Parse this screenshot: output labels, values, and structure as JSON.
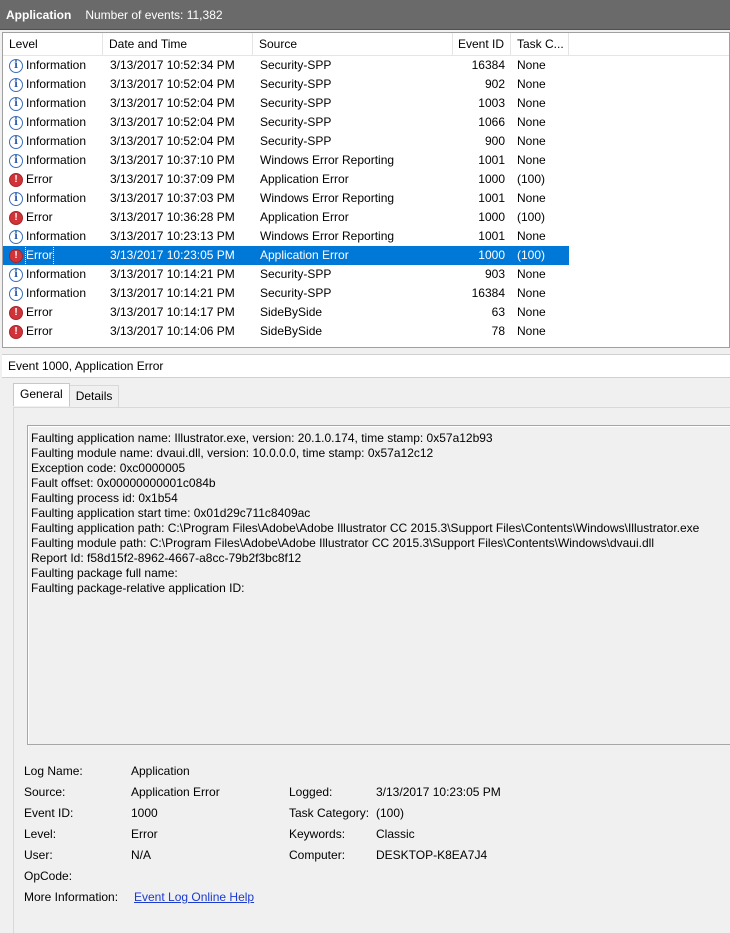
{
  "header": {
    "title": "Application",
    "count_text": "Number of events: 11,382"
  },
  "columns": {
    "level": "Level",
    "date": "Date and Time",
    "source": "Source",
    "event_id": "Event ID",
    "task": "Task C..."
  },
  "rows": [
    {
      "level": "Information",
      "date": "3/13/2017 10:52:34 PM",
      "source": "Security-SPP",
      "id": "16384",
      "task": "None",
      "icon": "info-icon"
    },
    {
      "level": "Information",
      "date": "3/13/2017 10:52:04 PM",
      "source": "Security-SPP",
      "id": "902",
      "task": "None",
      "icon": "info-icon"
    },
    {
      "level": "Information",
      "date": "3/13/2017 10:52:04 PM",
      "source": "Security-SPP",
      "id": "1003",
      "task": "None",
      "icon": "info-icon"
    },
    {
      "level": "Information",
      "date": "3/13/2017 10:52:04 PM",
      "source": "Security-SPP",
      "id": "1066",
      "task": "None",
      "icon": "info-icon"
    },
    {
      "level": "Information",
      "date": "3/13/2017 10:52:04 PM",
      "source": "Security-SPP",
      "id": "900",
      "task": "None",
      "icon": "info-icon"
    },
    {
      "level": "Information",
      "date": "3/13/2017 10:37:10 PM",
      "source": "Windows Error Reporting",
      "id": "1001",
      "task": "None",
      "icon": "info-icon"
    },
    {
      "level": "Error",
      "date": "3/13/2017 10:37:09 PM",
      "source": "Application Error",
      "id": "1000",
      "task": "(100)",
      "icon": "error-icon"
    },
    {
      "level": "Information",
      "date": "3/13/2017 10:37:03 PM",
      "source": "Windows Error Reporting",
      "id": "1001",
      "task": "None",
      "icon": "info-icon"
    },
    {
      "level": "Error",
      "date": "3/13/2017 10:36:28 PM",
      "source": "Application Error",
      "id": "1000",
      "task": "(100)",
      "icon": "error-icon"
    },
    {
      "level": "Information",
      "date": "3/13/2017 10:23:13 PM",
      "source": "Windows Error Reporting",
      "id": "1001",
      "task": "None",
      "icon": "info-icon"
    },
    {
      "level": "Error",
      "date": "3/13/2017 10:23:05 PM",
      "source": "Application Error",
      "id": "1000",
      "task": "(100)",
      "icon": "error-icon",
      "selected": true
    },
    {
      "level": "Information",
      "date": "3/13/2017 10:14:21 PM",
      "source": "Security-SPP",
      "id": "903",
      "task": "None",
      "icon": "info-icon"
    },
    {
      "level": "Information",
      "date": "3/13/2017 10:14:21 PM",
      "source": "Security-SPP",
      "id": "16384",
      "task": "None",
      "icon": "info-icon"
    },
    {
      "level": "Error",
      "date": "3/13/2017 10:14:17 PM",
      "source": "SideBySide",
      "id": "63",
      "task": "None",
      "icon": "error-icon"
    },
    {
      "level": "Error",
      "date": "3/13/2017 10:14:06 PM",
      "source": "SideBySide",
      "id": "78",
      "task": "None",
      "icon": "error-icon"
    }
  ],
  "detail": {
    "title": "Event 1000, Application Error",
    "tabs": [
      "General",
      "Details"
    ],
    "description": [
      "Faulting application name: Illustrator.exe, version: 20.1.0.174, time stamp: 0x57a12b93",
      "Faulting module name: dvaui.dll, version: 10.0.0.0, time stamp: 0x57a12c12",
      "Exception code: 0xc0000005",
      "Fault offset: 0x00000000001c084b",
      "Faulting process id: 0x1b54",
      "Faulting application start time: 0x01d29c711c8409ac",
      "Faulting application path: C:\\Program Files\\Adobe\\Adobe Illustrator CC 2015.3\\Support Files\\Contents\\Windows\\Illustrator.exe",
      "Faulting module path: C:\\Program Files\\Adobe\\Adobe Illustrator CC 2015.3\\Support Files\\Contents\\Windows\\dvaui.dll",
      "Report Id: f58d15f2-8962-4667-a8cc-79b2f3bc8f12",
      "Faulting package full name:",
      "Faulting package-relative application ID:"
    ],
    "props": {
      "log_name_label": "Log Name:",
      "log_name": "Application",
      "source_label": "Source:",
      "source": "Application Error",
      "logged_label": "Logged:",
      "logged": "3/13/2017 10:23:05 PM",
      "event_id_label": "Event ID:",
      "event_id": "1000",
      "task_label": "Task Category:",
      "task": "(100)",
      "level_label": "Level:",
      "level": "Error",
      "keywords_label": "Keywords:",
      "keywords": "Classic",
      "user_label": "User:",
      "user": "N/A",
      "computer_label": "Computer:",
      "computer": "DESKTOP-K8EA7J4",
      "opcode_label": "OpCode:",
      "opcode": "",
      "more_info_label": "More Information:",
      "more_info_link": "Event Log Online Help"
    }
  }
}
